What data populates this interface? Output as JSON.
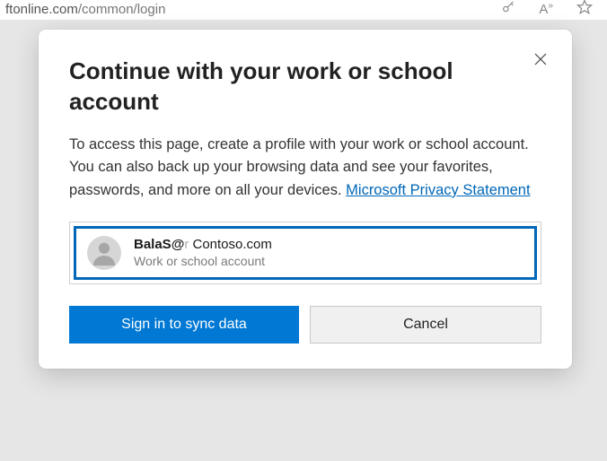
{
  "address_bar": {
    "url_prefix": "ftonline.com",
    "url_path": "/common/login"
  },
  "dialog": {
    "title": "Continue with your work or school account",
    "body_text": "To access this page, create a profile with your work or school account. You can also back up your browsing data and see your favorites, passwords, and more on all your devices. ",
    "privacy_link_label": "Microsoft Privacy Statement",
    "account": {
      "email_user": "BalaS@",
      "email_fade": "r",
      "email_domain": "Contoso.com",
      "type_label": "Work or school account"
    },
    "buttons": {
      "primary": "Sign in to sync data",
      "secondary": "Cancel"
    }
  }
}
